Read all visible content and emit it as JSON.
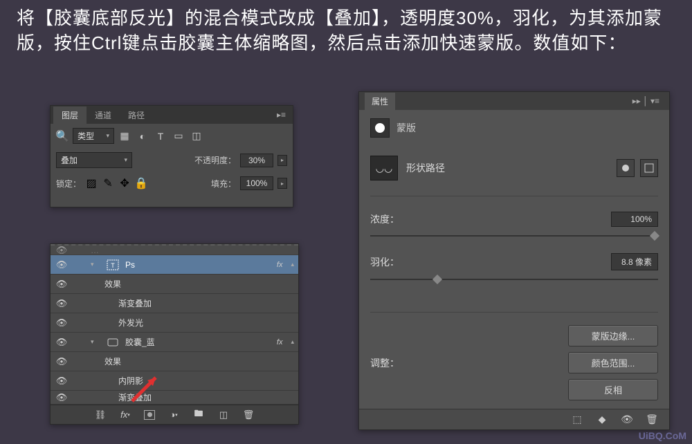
{
  "instruction": "将【胶囊底部反光】的混合模式改成【叠加】，透明度30%，羽化，为其添加蒙版，按住Ctrl键点击胶囊主体缩略图，然后点击添加快速蒙版。数值如下：",
  "layers_panel": {
    "tabs": [
      "图层",
      "通道",
      "路径"
    ],
    "filter_label": "类型",
    "blend_mode": "叠加",
    "opacity_label": "不透明度：",
    "opacity_value": "30%",
    "lock_label": "锁定：",
    "fill_label": "填充：",
    "fill_value": "100%"
  },
  "layers_list": {
    "items": [
      {
        "name": "Ps",
        "selected": true,
        "fx": true,
        "type": "text"
      },
      {
        "name": "效果",
        "indent": 2,
        "eye": true
      },
      {
        "name": "渐变叠加",
        "indent": 3,
        "eye": true
      },
      {
        "name": "外发光",
        "indent": 3,
        "eye": true
      },
      {
        "name": "胶囊_蓝",
        "indent": 1,
        "eye": true,
        "fx": true,
        "type": "shape"
      },
      {
        "name": "效果",
        "indent": 2,
        "eye": true
      },
      {
        "name": "内阴影",
        "indent": 3,
        "eye": true
      },
      {
        "name": "渐变叠加",
        "indent": 3,
        "eye": true
      }
    ]
  },
  "properties": {
    "title": "属性",
    "mask_label": "蒙版",
    "shape_path_label": "形状路径",
    "density_label": "浓度：",
    "density_value": "100%",
    "feather_label": "羽化：",
    "feather_value": "8.8 像素",
    "adjust_label": "调整：",
    "buttons": {
      "mask_edge": "蒙版边缘...",
      "color_range": "颜色范围...",
      "invert": "反相"
    }
  },
  "watermark": "UiBQ.CoM"
}
